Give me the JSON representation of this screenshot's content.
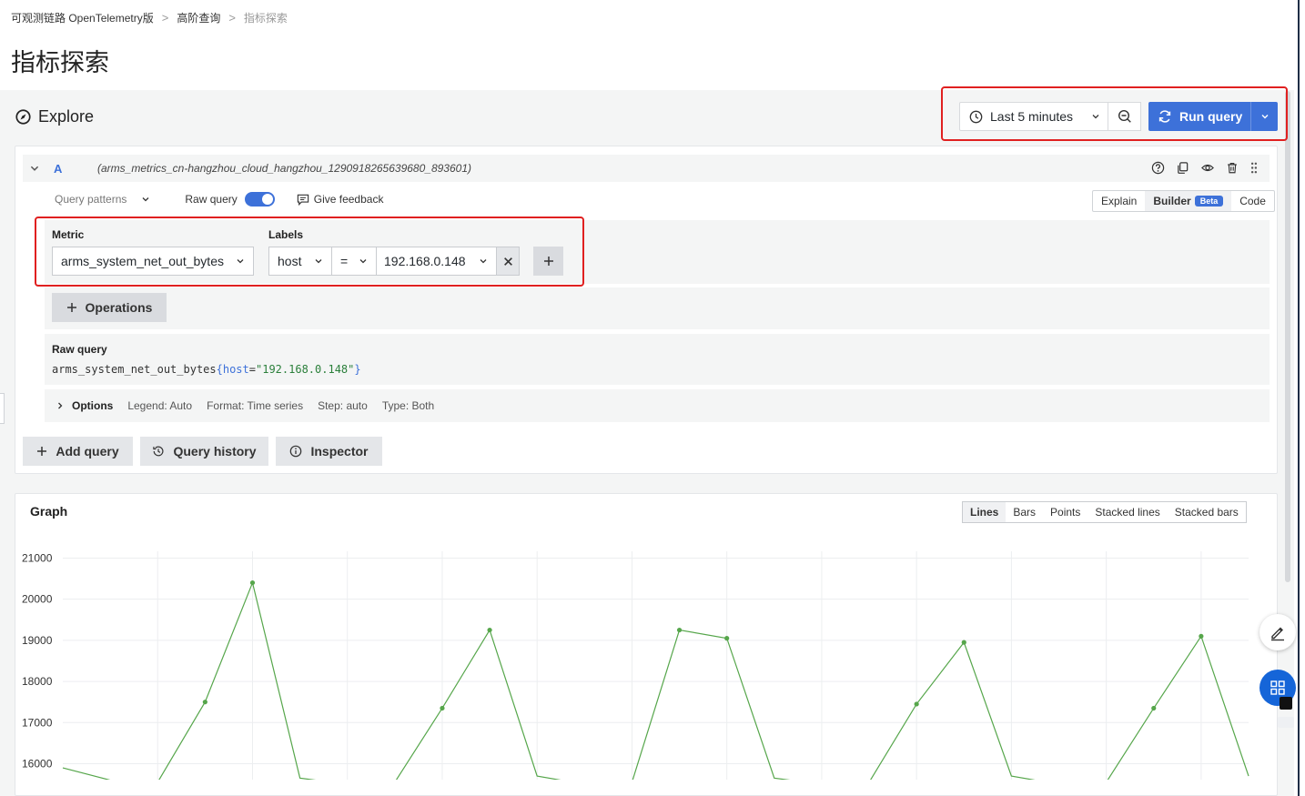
{
  "breadcrumb": {
    "items": [
      "可观测链路 OpenTelemetry版",
      "高阶查询",
      "指标探索"
    ],
    "separator": ">"
  },
  "page_title": "指标探索",
  "explore": {
    "title": "Explore",
    "time_range_label": "Last 5 minutes",
    "run_query_label": "Run query"
  },
  "query": {
    "ref_id": "A",
    "datasource": "(arms_metrics_cn-hangzhou_cloud_hangzhou_1290918265639680_893601)",
    "query_patterns_label": "Query patterns",
    "raw_query_toggle_label": "Raw query",
    "raw_query_enabled": true,
    "feedback_label": "Give feedback",
    "modes": {
      "explain": "Explain",
      "builder": "Builder",
      "beta": "Beta",
      "code": "Code"
    },
    "metric_label": "Metric",
    "metric_value": "arms_system_net_out_bytes",
    "labels_label": "Labels",
    "label_key": "host",
    "label_operator": "=",
    "label_value": "192.168.0.148",
    "operations_label": "Operations",
    "raw_query_title": "Raw query",
    "raw_query_metric": "arms_system_net_out_bytes",
    "raw_query_open": "{",
    "raw_query_key": "host",
    "raw_query_eq": "=",
    "raw_query_val": "\"192.168.0.148\"",
    "raw_query_close": "}",
    "options": {
      "title": "Options",
      "legend": "Legend: Auto",
      "format": "Format: Time series",
      "step": "Step: auto",
      "type": "Type: Both"
    }
  },
  "actions": {
    "add_query": "Add query",
    "query_history": "Query history",
    "inspector": "Inspector"
  },
  "graph": {
    "title": "Graph",
    "vis_types": [
      "Lines",
      "Bars",
      "Points",
      "Stacked lines",
      "Stacked bars"
    ],
    "active_vis": "Lines"
  },
  "colors": {
    "accent": "#3d71d9",
    "highlight": "#e02020",
    "series": "#56a64b"
  },
  "chart_data": {
    "type": "line",
    "title": "",
    "xlabel": "",
    "ylabel": "",
    "yticks": [
      21000,
      20000,
      19000,
      18000,
      17000,
      16000
    ],
    "ylim": [
      15650,
      21300
    ],
    "grid": true,
    "series": [
      {
        "values": [
          15900,
          15600,
          15550,
          17500,
          20400,
          15650,
          15500,
          15550,
          17350,
          19250,
          15700,
          15500,
          15550,
          19250,
          19050,
          15650,
          15500,
          15550,
          17450,
          18950,
          15700,
          15500,
          15550,
          17350,
          19100,
          15700
        ]
      }
    ]
  }
}
